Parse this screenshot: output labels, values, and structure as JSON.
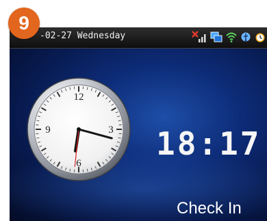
{
  "badge": {
    "number": "9",
    "color": "#e2661e"
  },
  "status_bar": {
    "date_day": "-02-27  Wednesday",
    "icons": [
      "signal-no-sim-icon",
      "network-icon",
      "wifi-icon",
      "usb-icon",
      "alarm-clock-icon"
    ]
  },
  "clock": {
    "hour_labels": {
      "twelve": "12",
      "three": "3",
      "six": "6",
      "nine": "9"
    },
    "time": {
      "hour": 18,
      "minute": 17,
      "second": 31
    }
  },
  "digital_time": "18:17",
  "check_label": "Check In",
  "colors": {
    "accent": "#e2661e",
    "screen_blue": "#0d2c78",
    "second_hand": "#d81e1e"
  }
}
